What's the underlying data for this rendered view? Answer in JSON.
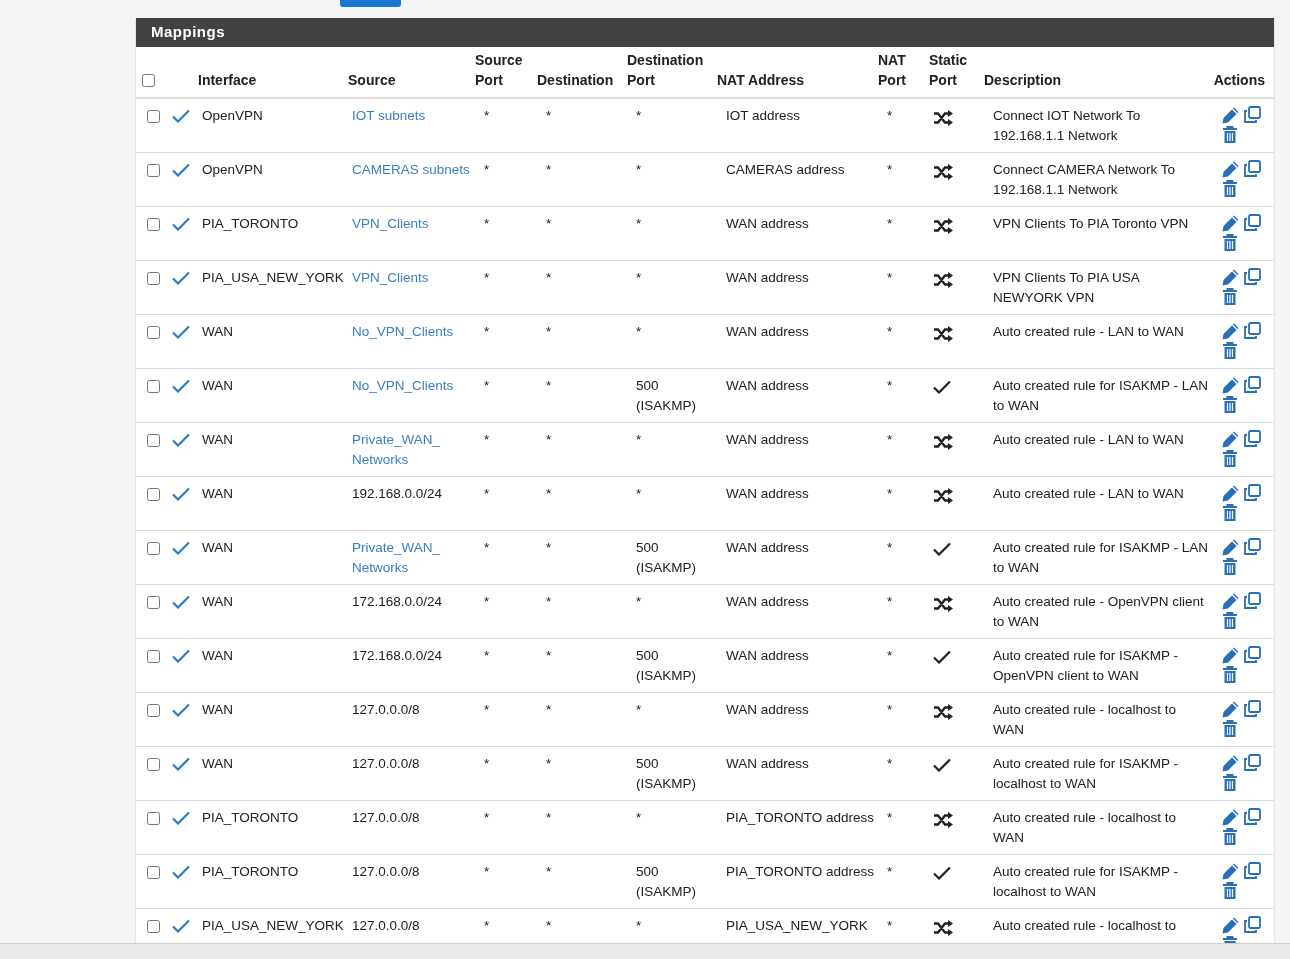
{
  "panel": {
    "title": "Mappings"
  },
  "select_all": {
    "checked": false
  },
  "columns": [
    "",
    "",
    "Interface",
    "Source",
    "Source Port",
    "Destination",
    "Destination Port",
    "NAT Address",
    "NAT Port",
    "Static Port",
    "Description",
    "Actions"
  ],
  "rows": [
    {
      "checked": false,
      "enabled": true,
      "interface": "OpenVPN",
      "source": "IOT subnets",
      "source_alias": true,
      "source_port": "*",
      "destination": "*",
      "destination_port": "*",
      "nat_address": "IOT address",
      "nat_port": "*",
      "static_port": false,
      "description": "Connect IOT Network To 192.168.1.1 Network"
    },
    {
      "checked": false,
      "enabled": true,
      "interface": "OpenVPN",
      "source": "CAMERAS subnets",
      "source_alias": true,
      "source_port": "*",
      "destination": "*",
      "destination_port": "*",
      "nat_address": "CAMERAS address",
      "nat_port": "*",
      "static_port": false,
      "description": "Connect CAMERA Network To 192.168.1.1 Network"
    },
    {
      "checked": false,
      "enabled": true,
      "interface": "PIA_TORONTO",
      "source": "VPN_Clients",
      "source_alias": true,
      "source_port": "*",
      "destination": "*",
      "destination_port": "*",
      "nat_address": "WAN address",
      "nat_port": "*",
      "static_port": false,
      "description": "VPN Clients To PIA Toronto VPN"
    },
    {
      "checked": false,
      "enabled": true,
      "interface": "PIA_USA_NEW_YORK",
      "source": "VPN_Clients",
      "source_alias": true,
      "source_port": "*",
      "destination": "*",
      "destination_port": "*",
      "nat_address": "WAN address",
      "nat_port": "*",
      "static_port": false,
      "description": "VPN Clients To PIA USA NEWYORK VPN"
    },
    {
      "checked": false,
      "enabled": true,
      "interface": "WAN",
      "source": "No_VPN_Clients",
      "source_alias": true,
      "source_port": "*",
      "destination": "*",
      "destination_port": "*",
      "nat_address": "WAN address",
      "nat_port": "*",
      "static_port": false,
      "description": "Auto created rule - LAN to WAN"
    },
    {
      "checked": false,
      "enabled": true,
      "interface": "WAN",
      "source": "No_VPN_Clients",
      "source_alias": true,
      "source_port": "*",
      "destination": "*",
      "destination_port": "500 (ISAKMP)",
      "nat_address": "WAN address",
      "nat_port": "*",
      "static_port": true,
      "description": "Auto created rule for ISAKMP - LAN to WAN"
    },
    {
      "checked": false,
      "enabled": true,
      "interface": "WAN",
      "source": "Private_WAN_ Networks",
      "source_alias": true,
      "source_port": "*",
      "destination": "*",
      "destination_port": "*",
      "nat_address": "WAN address",
      "nat_port": "*",
      "static_port": false,
      "description": "Auto created rule - LAN to WAN"
    },
    {
      "checked": false,
      "enabled": true,
      "interface": "WAN",
      "source": "192.168.0.0/24",
      "source_alias": false,
      "source_port": "*",
      "destination": "*",
      "destination_port": "*",
      "nat_address": "WAN address",
      "nat_port": "*",
      "static_port": false,
      "description": "Auto created rule - LAN to WAN"
    },
    {
      "checked": false,
      "enabled": true,
      "interface": "WAN",
      "source": "Private_WAN_ Networks",
      "source_alias": true,
      "source_port": "*",
      "destination": "*",
      "destination_port": "500 (ISAKMP)",
      "nat_address": "WAN address",
      "nat_port": "*",
      "static_port": true,
      "description": "Auto created rule for ISAKMP - LAN to WAN"
    },
    {
      "checked": false,
      "enabled": true,
      "interface": "WAN",
      "source": "172.168.0.0/24",
      "source_alias": false,
      "source_port": "*",
      "destination": "*",
      "destination_port": "*",
      "nat_address": "WAN address",
      "nat_port": "*",
      "static_port": false,
      "description": "Auto created rule - OpenVPN client to WAN"
    },
    {
      "checked": false,
      "enabled": true,
      "interface": "WAN",
      "source": "172.168.0.0/24",
      "source_alias": false,
      "source_port": "*",
      "destination": "*",
      "destination_port": "500 (ISAKMP)",
      "nat_address": "WAN address",
      "nat_port": "*",
      "static_port": true,
      "description": "Auto created rule for ISAKMP - OpenVPN client to WAN"
    },
    {
      "checked": false,
      "enabled": true,
      "interface": "WAN",
      "source": "127.0.0.0/8",
      "source_alias": false,
      "source_port": "*",
      "destination": "*",
      "destination_port": "*",
      "nat_address": "WAN address",
      "nat_port": "*",
      "static_port": false,
      "description": "Auto created rule - localhost to WAN"
    },
    {
      "checked": false,
      "enabled": true,
      "interface": "WAN",
      "source": "127.0.0.0/8",
      "source_alias": false,
      "source_port": "*",
      "destination": "*",
      "destination_port": "500 (ISAKMP)",
      "nat_address": "WAN address",
      "nat_port": "*",
      "static_port": true,
      "description": "Auto created rule for ISAKMP - localhost to WAN"
    },
    {
      "checked": false,
      "enabled": true,
      "interface": "PIA_TORONTO",
      "source": "127.0.0.0/8",
      "source_alias": false,
      "source_port": "*",
      "destination": "*",
      "destination_port": "*",
      "nat_address": "PIA_TORONTO address",
      "nat_port": "*",
      "static_port": false,
      "description": "Auto created rule - localhost to WAN"
    },
    {
      "checked": false,
      "enabled": true,
      "interface": "PIA_TORONTO",
      "source": "127.0.0.0/8",
      "source_alias": false,
      "source_port": "*",
      "destination": "*",
      "destination_port": "500 (ISAKMP)",
      "nat_address": "PIA_TORONTO address",
      "nat_port": "*",
      "static_port": true,
      "description": "Auto created rule for ISAKMP - localhost to WAN"
    },
    {
      "checked": false,
      "enabled": true,
      "interface": "PIA_USA_NEW_YORK",
      "source": "127.0.0.0/8",
      "source_alias": false,
      "source_port": "*",
      "destination": "*",
      "destination_port": "*",
      "nat_address": "PIA_USA_NEW_YORK",
      "nat_port": "*",
      "static_port": false,
      "description": "Auto created rule - localhost to"
    }
  ]
}
